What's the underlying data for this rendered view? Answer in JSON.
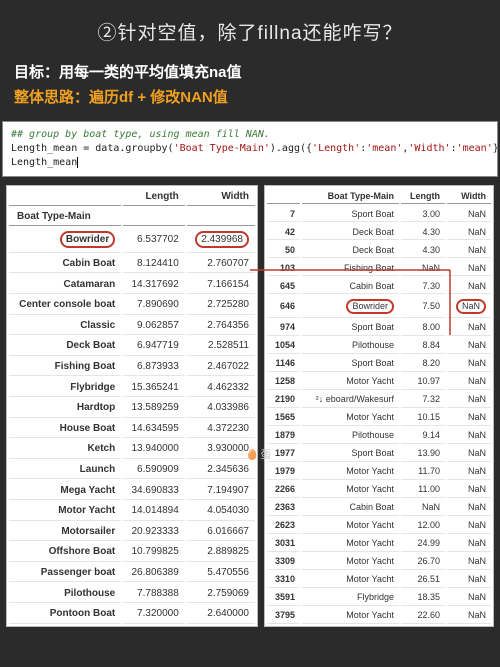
{
  "title": "②针对空值，除了fillna还能咋写？",
  "goal_label": "目标：",
  "goal_text": "用每一类的平均值填充na值",
  "strategy_label": "整体思路：",
  "strategy_text": "遍历df + 修改NAN值",
  "code": {
    "comment": "## group by boat type, using mean fill NAN.",
    "line2_a": "Length_mean = data.groupby(",
    "line2_b": "'Boat Type-Main'",
    "line2_c": ").agg({",
    "line2_d": "'Length'",
    "line2_e": ":",
    "line2_f": "'mean'",
    "line2_g": ",",
    "line2_h": "'Width'",
    "line2_i": ":",
    "line2_j": "'mean'",
    "line2_k": "})",
    "line3": "Length_mean"
  },
  "left_table": {
    "index_name": "Boat Type-Main",
    "headers": [
      "Length",
      "Width"
    ],
    "rows": [
      {
        "name": "Bowrider",
        "length": "6.537702",
        "width": "2.439968",
        "ring": true
      },
      {
        "name": "Cabin Boat",
        "length": "8.124410",
        "width": "2.760707"
      },
      {
        "name": "Catamaran",
        "length": "14.317692",
        "width": "7.166154"
      },
      {
        "name": "Center console boat",
        "length": "7.890690",
        "width": "2.725280"
      },
      {
        "name": "Classic",
        "length": "9.062857",
        "width": "2.764356"
      },
      {
        "name": "Deck Boat",
        "length": "6.947719",
        "width": "2.528511"
      },
      {
        "name": "Fishing Boat",
        "length": "6.873933",
        "width": "2.467022"
      },
      {
        "name": "Flybridge",
        "length": "15.365241",
        "width": "4.462332"
      },
      {
        "name": "Hardtop",
        "length": "13.589259",
        "width": "4.033986"
      },
      {
        "name": "House Boat",
        "length": "14.634595",
        "width": "4.372230"
      },
      {
        "name": "Ketch",
        "length": "13.940000",
        "width": "3.930000"
      },
      {
        "name": "Launch",
        "length": "6.590909",
        "width": "2.345636"
      },
      {
        "name": "Mega Yacht",
        "length": "34.690833",
        "width": "7.194907"
      },
      {
        "name": "Motor Yacht",
        "length": "14.014894",
        "width": "4.054030"
      },
      {
        "name": "Motorsailer",
        "length": "20.923333",
        "width": "6.016667"
      },
      {
        "name": "Offshore Boat",
        "length": "10.799825",
        "width": "2.889825"
      },
      {
        "name": "Passenger boat",
        "length": "26.806389",
        "width": "5.470556"
      },
      {
        "name": "Pilothouse",
        "length": "7.788388",
        "width": "2.759069"
      },
      {
        "name": "Pontoon Boat",
        "length": "7.320000",
        "width": "2.640000"
      }
    ]
  },
  "right_table": {
    "headers": [
      "",
      "Boat Type-Main",
      "Length",
      "Width"
    ],
    "rows": [
      {
        "idx": "7",
        "type": "Sport Boat",
        "length": "3.00",
        "width": "NaN"
      },
      {
        "idx": "42",
        "type": "Deck Boat",
        "length": "4.30",
        "width": "NaN"
      },
      {
        "idx": "50",
        "type": "Deck Boat",
        "length": "4.30",
        "width": "NaN"
      },
      {
        "idx": "103",
        "type": "Fishing Boat",
        "length": "NaN",
        "width": "NaN"
      },
      {
        "idx": "645",
        "type": "Cabin Boat",
        "length": "7.30",
        "width": "NaN"
      },
      {
        "idx": "646",
        "type": "Bowrider",
        "length": "7.50",
        "width": "NaN",
        "ring": true
      },
      {
        "idx": "974",
        "type": "Sport Boat",
        "length": "8.00",
        "width": "NaN"
      },
      {
        "idx": "1054",
        "type": "Pilothouse",
        "length": "8.84",
        "width": "NaN"
      },
      {
        "idx": "1146",
        "type": "Sport Boat",
        "length": "8.20",
        "width": "NaN"
      },
      {
        "idx": "1258",
        "type": "Motor Yacht",
        "length": "10.97",
        "width": "NaN"
      },
      {
        "idx": "2190",
        "type": "²↓ eboard/Wakesurf",
        "length": "7.32",
        "width": "NaN"
      },
      {
        "idx": "1565",
        "type": "Motor Yacht",
        "length": "10.15",
        "width": "NaN"
      },
      {
        "idx": "1879",
        "type": "Pilothouse",
        "length": "9.14",
        "width": "NaN"
      },
      {
        "idx": "1977",
        "type": "Sport Boat",
        "length": "13.90",
        "width": "NaN"
      },
      {
        "idx": "1979",
        "type": "Motor Yacht",
        "length": "11.70",
        "width": "NaN"
      },
      {
        "idx": "2266",
        "type": "Motor Yacht",
        "length": "11.00",
        "width": "NaN"
      },
      {
        "idx": "2363",
        "type": "Cabin Boat",
        "length": "NaN",
        "width": "NaN"
      },
      {
        "idx": "2623",
        "type": "Motor Yacht",
        "length": "12.00",
        "width": "NaN"
      },
      {
        "idx": "3031",
        "type": "Motor Yacht",
        "length": "24.99",
        "width": "NaN"
      },
      {
        "idx": "3309",
        "type": "Motor Yacht",
        "length": "26.70",
        "width": "NaN"
      },
      {
        "idx": "3310",
        "type": "Motor Yacht",
        "length": "26.51",
        "width": "NaN"
      },
      {
        "idx": "3591",
        "type": "Flybridge",
        "length": "18.35",
        "width": "NaN"
      },
      {
        "idx": "3795",
        "type": "Motor Yacht",
        "length": "22.60",
        "width": "NaN"
      }
    ]
  },
  "egg_text": "蛋"
}
